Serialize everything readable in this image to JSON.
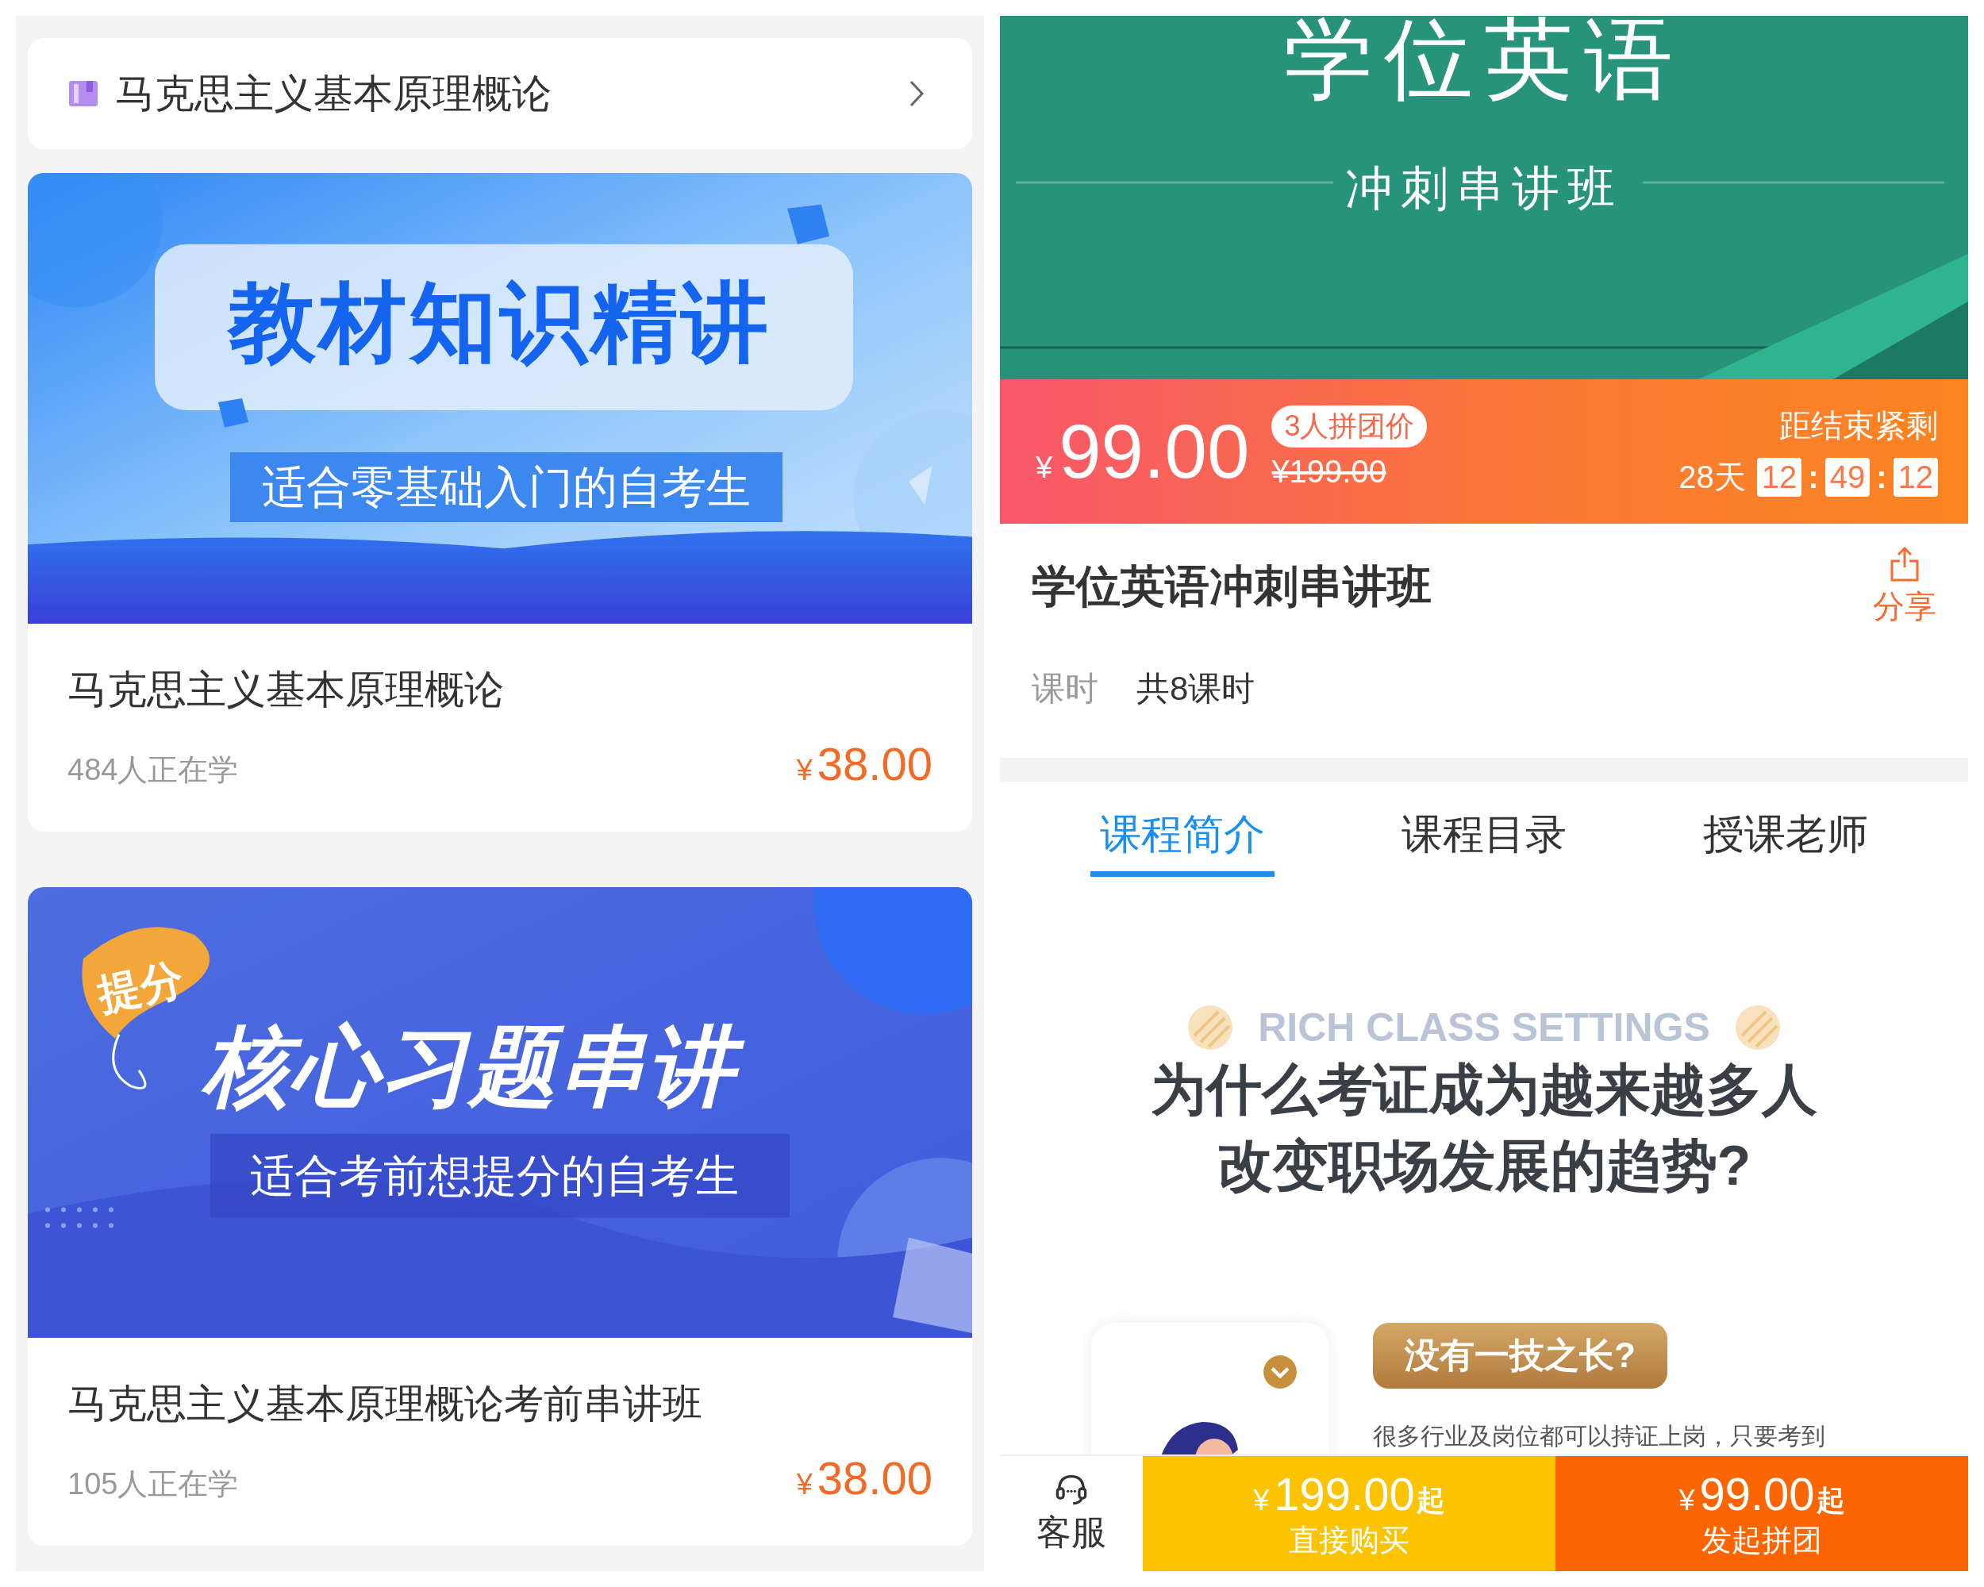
{
  "course_header": {
    "title": "马克思主义基本原理概论"
  },
  "courses": [
    {
      "banner": {
        "kind": "knowledge",
        "title": "教材知识精讲",
        "subtitle": "适合零基础入门的自考生"
      },
      "name": "马克思主义基本原理概论",
      "learners": "484人正在学",
      "currency": "¥",
      "price": "38.00"
    },
    {
      "banner": {
        "kind": "exercise",
        "tag": "提分",
        "title": "核心习题串讲",
        "subtitle": "适合考前想提分的自考生"
      },
      "name": "马克思主义基本原理概论考前串讲班",
      "learners": "105人正在学",
      "currency": "¥",
      "price": "38.00"
    }
  ],
  "product": {
    "cover": {
      "title": "学位英语",
      "subtitle": "冲刺串讲班"
    },
    "group_price": {
      "currency": "¥",
      "price": "99.00",
      "badge": "3人拼团价",
      "original_price": "¥199.00",
      "countdown_label": "距结束紧剩",
      "days": "28天",
      "countdown": [
        {
          "kind": "box",
          "text": "12"
        },
        {
          "kind": "sep",
          "text": ":"
        },
        {
          "kind": "box",
          "text": "49"
        },
        {
          "kind": "sep",
          "text": ":"
        },
        {
          "kind": "box",
          "text": "12"
        }
      ]
    },
    "title": "学位英语冲刺串讲班",
    "share": "分享",
    "lessons_label": "课时",
    "lessons_value": "共8课时"
  },
  "tabs": [
    {
      "label": "课程简介",
      "selected": true
    },
    {
      "label": "课程目录",
      "selected": false
    },
    {
      "label": "授课老师",
      "selected": false
    }
  ],
  "intro": {
    "watermark": "RICH CLASS SETTINGS",
    "heading_lines": [
      "为什么考证成为越来越多人",
      "改变职场发展的趋势?"
    ],
    "callout": "没有一技之长?",
    "body": "很多行业及岗位都可以持证上岗，只要考到"
  },
  "bottom_bar": {
    "service": "客服",
    "actions": [
      {
        "kind": "buy",
        "currency": "¥",
        "price": "199.00",
        "suffix": "起",
        "label": "直接购买"
      },
      {
        "kind": "group",
        "currency": "¥",
        "price": "99.00",
        "suffix": "起",
        "label": "发起拼团"
      }
    ]
  }
}
